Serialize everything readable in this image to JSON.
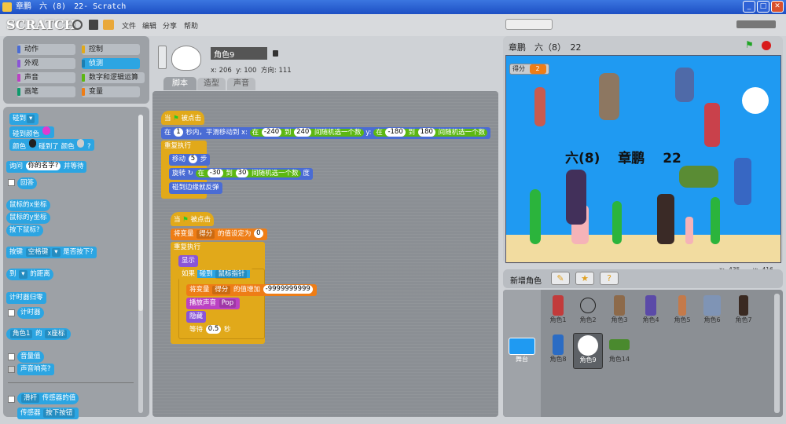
{
  "window": {
    "title": "章鹏　六 (8)　22- Scratch"
  },
  "menu": {
    "logo": "SCRATCH",
    "items": [
      "文件",
      "编辑",
      "分享",
      "帮助"
    ]
  },
  "categories": [
    {
      "label": "动作",
      "color": "#4a6cd4"
    },
    {
      "label": "控制",
      "color": "#e1a91a"
    },
    {
      "label": "外观",
      "color": "#8a55d7"
    },
    {
      "label": "侦测",
      "color": "#2ca5e2"
    },
    {
      "label": "声音",
      "color": "#bb42c3"
    },
    {
      "label": "数字和逻辑运算",
      "color": "#5cb712"
    },
    {
      "label": "画笔",
      "color": "#0e9a6c"
    },
    {
      "label": "变量",
      "color": "#ee7d16"
    }
  ],
  "palette": {
    "touching": "碰到",
    "touching_color": "碰到颜色",
    "color_touch_a": "颜色",
    "color_touch_b": "碰到了 颜色",
    "ask_a": "询问",
    "ask_value": "你的名字?",
    "ask_b": "并等待",
    "answer": "回答",
    "mousex": "鼠标的x坐标",
    "mousey": "鼠标的y坐标",
    "mousedown": "按下鼠标?",
    "key_a": "按键",
    "key_value": "空格键",
    "key_b": "是否按下?",
    "dist_a": "到",
    "dist_b": "的距离",
    "timer_reset": "计时器归零",
    "timer": "计时器",
    "of_a": "角色1",
    "of_b": "的",
    "of_c": "x座标",
    "loudness": "音量值",
    "loud": "声音响亮?",
    "slider_a": "滑杆",
    "slider_b": "传感器的值",
    "sensor_a": "传感器",
    "sensor_b": "按下按钮"
  },
  "sprite_header": {
    "name": "角色9",
    "x_label": "x:",
    "x": "206",
    "y_label": "y:",
    "y": "100",
    "dir_label": "方向:",
    "dir": "111"
  },
  "tabs": [
    "脚本",
    "造型",
    "声音"
  ],
  "script1": {
    "when": "当",
    "clicked": "被点击",
    "glide_a": "在",
    "glide_n": "1",
    "glide_b": "秒内，平滑移动到 x:",
    "r1a": "在",
    "r1min": "-240",
    "r1to": "到",
    "r1max": "240",
    "r1c": "间随机选一个数",
    "y_label": "y:",
    "r2a": "在",
    "r2min": "-180",
    "r2to": "到",
    "r2max": "180",
    "r2c": "间随机选一个数",
    "forever": "重复执行",
    "move_a": "移动",
    "move_n": "5",
    "move_b": "步",
    "turn_a": "旋转",
    "r3a": "在",
    "r3min": "-30",
    "r3to": "到",
    "r3max": "30",
    "r3c": "间随机选一个数",
    "turn_b": "度",
    "bounce": "碰到边缘就反弹"
  },
  "script2": {
    "when": "当",
    "clicked": "被点击",
    "set_a": "将变量",
    "set_var": "得分",
    "set_b": "的值设定为",
    "set_v": "0",
    "forever": "重复执行",
    "show": "显示",
    "if": "如果",
    "touch": "碰到",
    "touch_t": "鼠标指针",
    "change_a": "将变量",
    "change_var": "得分",
    "change_b": "的值增加",
    "change_v": "-9999999999",
    "play": "播放声音",
    "snd": "Pop",
    "hide": "隐藏",
    "wait": "等待",
    "wait_n": "0.5",
    "wait_b": "秒"
  },
  "stage": {
    "title": "章鹏　六（8）　22",
    "score_label": "得分",
    "score_value": "2",
    "big_text": "六(8)　 章鹏　 22",
    "mouse_x": "x: -435",
    "mouse_y": "y: -416"
  },
  "new_sprite": {
    "label": "新增角色"
  },
  "sprites": [
    {
      "name": "角色1",
      "color": "#c23b3b"
    },
    {
      "name": "角色2",
      "color": "#333333"
    },
    {
      "name": "角色3",
      "color": "#8d6a4a"
    },
    {
      "name": "角色4",
      "color": "#5b4aa8"
    },
    {
      "name": "角色5",
      "color": "#c47a4a"
    },
    {
      "name": "角色6",
      "color": "#7f94b5"
    },
    {
      "name": "角色7",
      "color": "#3a2a22"
    },
    {
      "name": "角色8",
      "color": "#2b6cc4"
    },
    {
      "name": "角色9",
      "color": "#ffffff"
    },
    {
      "name": "角色14",
      "color": "#4a8a2e"
    }
  ],
  "stage_thumb": {
    "label": "舞台"
  }
}
